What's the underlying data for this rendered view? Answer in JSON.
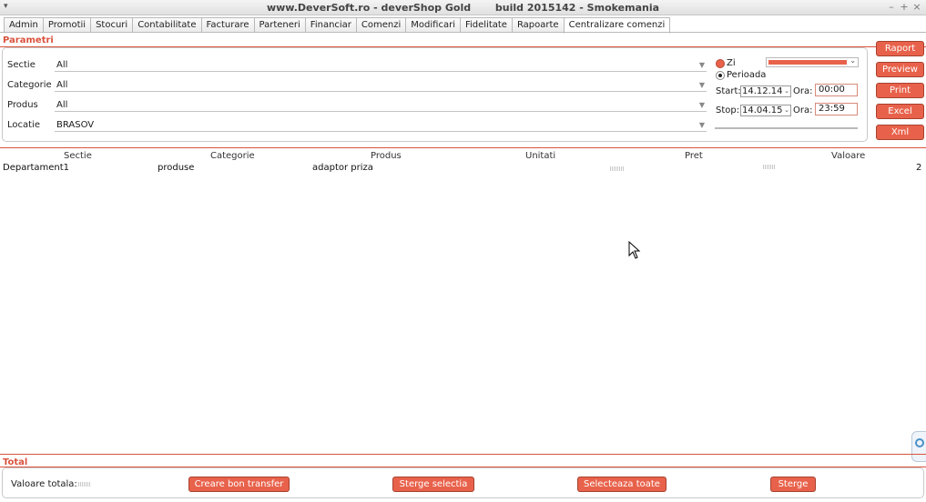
{
  "window": {
    "title": "www.DeverSoft.ro - deverShop Gold       build 2015142 - Smokemania",
    "menu_glyph": "▾",
    "controls": [
      "–",
      "+",
      "×"
    ]
  },
  "tabs": [
    {
      "label": "Admin"
    },
    {
      "label": "Promotii"
    },
    {
      "label": "Stocuri"
    },
    {
      "label": "Contabilitate"
    },
    {
      "label": "Facturare"
    },
    {
      "label": "Parteneri"
    },
    {
      "label": "Financiar"
    },
    {
      "label": "Comenzi"
    },
    {
      "label": "Modificari"
    },
    {
      "label": "Fidelitate"
    },
    {
      "label": "Rapoarte"
    },
    {
      "label": "Centralizare comenzi",
      "active": true
    }
  ],
  "parametri": {
    "heading": "Parametri",
    "fields": [
      {
        "label": "Sectie",
        "value": "All"
      },
      {
        "label": "Categorie",
        "value": "All"
      },
      {
        "label": "Produs",
        "value": "All"
      },
      {
        "label": "Locatie",
        "value": "BRASOV"
      }
    ],
    "period": {
      "zi_label": "Zi",
      "perioada_label": "Perioada",
      "selected": "Perioada",
      "start_label": "Start:",
      "start_date": "14.12.14",
      "stop_label": "Stop:",
      "stop_date": "14.04.15",
      "ora_label": "Ora:",
      "start_time": "00:00",
      "stop_time": "23:59"
    }
  },
  "actions": [
    "Raport",
    "Preview",
    "Print",
    "Excel",
    "Xml"
  ],
  "grid": {
    "columns": [
      "Sectie",
      "Categorie",
      "Produs",
      "Unitati",
      "Pret",
      "Valoare"
    ],
    "rows": [
      {
        "sectie": "Departament1",
        "categorie": "produse",
        "produs": "adaptor priza",
        "unitati": "",
        "pret": "",
        "valoare": "2"
      }
    ]
  },
  "total": {
    "heading": "Total",
    "valoare_label": "Valoare totala:",
    "buttons": [
      "Creare bon transfer",
      "Sterge selectia",
      "Selecteaza toate",
      "Sterge"
    ]
  },
  "colors": {
    "accent": "#e8624b",
    "heading": "#d9533d"
  },
  "icons": [
    "window-menu-icon",
    "minimize-icon",
    "maximize-icon",
    "close-icon",
    "dropdown-arrow-icon",
    "mouse-cursor-icon",
    "side-widget-icon"
  ]
}
